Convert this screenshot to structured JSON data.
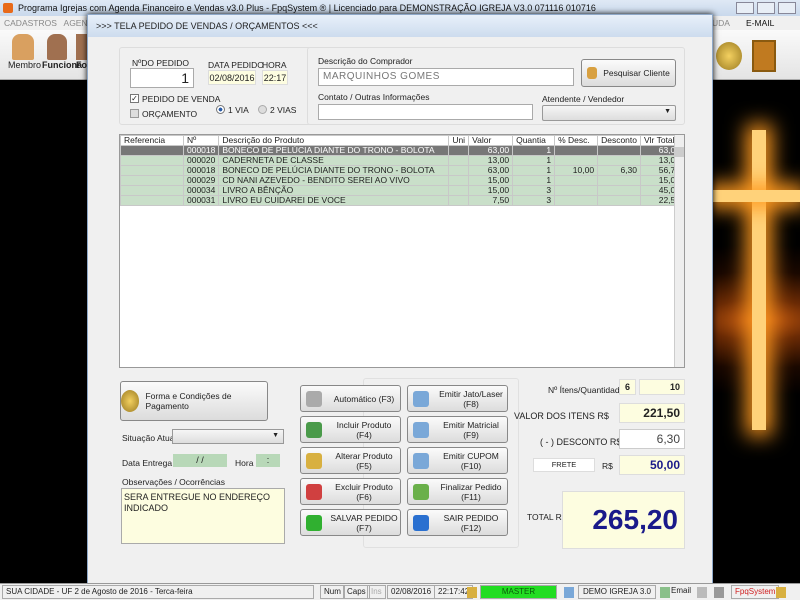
{
  "window": {
    "title": "Programa Igrejas com Agenda Financeiro e Vendas v3.0 Plus - FpqSystem ® | Licenciado para  DEMONSTRAÇÃO IGREJA V3.0 071116 010716"
  },
  "menu": {
    "items": [
      "CADASTROS",
      "AGENDA"
    ],
    "right": "UDA",
    "email": "E-MAIL"
  },
  "toolbar": {
    "items": [
      "Membro",
      "Funcioná",
      "For"
    ]
  },
  "dialog": {
    "title": ">>>  TELA PEDIDO DE VENDAS / ORÇAMENTOS  <<<",
    "pedido": {
      "num_label": "NºDO PEDIDO",
      "num": "1",
      "data_label": "DATA PEDIDO",
      "data": "02/08/2016",
      "hora_label": "HORA",
      "hora": "22:17",
      "pedido_venda": "PEDIDO DE VENDA",
      "pedido_venda_checked": true,
      "orcamento": "ORÇAMENTO",
      "orcamento_checked": false,
      "via1": "1 VIA",
      "via2": "2 VIAS",
      "via_selected": "1 VIA"
    },
    "comprador": {
      "label": "Descrição do Comprador",
      "value": "MARQUINHOS GOMES",
      "pesquisar": "Pesquisar Cliente",
      "contato_label": "Contato / Outras Informações",
      "contato": "",
      "atendente_label": "Atendente / Vendedor",
      "atendente": ""
    },
    "table": {
      "headers": [
        "Referencia",
        "Nº",
        "Descrição do Produto",
        "Uni",
        "Valor",
        "Quantia",
        "% Desc.",
        "Desconto",
        "Vlr Total"
      ],
      "rows": [
        [
          "",
          "000018",
          "BONECO DE PELÚCIA DIANTE DO TRONO - BOLOTA",
          "",
          "63,00",
          "1",
          "",
          "",
          "63,00"
        ],
        [
          "",
          "000020",
          "CADERNETA DE CLASSE",
          "",
          "13,00",
          "1",
          "",
          "",
          "13,00"
        ],
        [
          "",
          "000018",
          "BONECO DE PELÚCIA DIANTE DO TRONO - BOLOTA",
          "",
          "63,00",
          "1",
          "10,00",
          "6,30",
          "56,70"
        ],
        [
          "",
          "000029",
          "CD NANI AZEVEDO - BENDITO SEREI AO VIVO",
          "",
          "15,00",
          "1",
          "",
          "",
          "15,00"
        ],
        [
          "",
          "000034",
          "LIVRO A BÊNÇÃO",
          "",
          "15,00",
          "3",
          "",
          "",
          "45,00"
        ],
        [
          "",
          "000031",
          "LIVRO EU CUIDAREI DE VOCE",
          "",
          "7,50",
          "3",
          "",
          "",
          "22,50"
        ]
      ]
    },
    "left": {
      "pagamento": "Forma e Condições de Pagamento",
      "situacao_label": "Situação Atual",
      "situacao": "",
      "data_entrega_label": "Data  Entrega",
      "data_entrega": " / /",
      "hora_label": "Hora",
      "hora": " :",
      "obs_label": "Observações / Ocorrências",
      "obs": "SERA ENTREGUE NO ENDEREÇO INDICADO"
    },
    "buttons": [
      [
        "Automático      (F3)",
        "Emitir Jato/Laser (F8)"
      ],
      [
        "Incluir Produto  (F4)",
        "Emitir Matricial  (F9)"
      ],
      [
        "Alterar Produto  (F5)",
        "Emitir CUPOM   (F10)"
      ],
      [
        "Excluir Produto  (F6)",
        "Finalizar Pedido  (F11)"
      ],
      [
        "SALVAR PEDIDO (F7)",
        "SAIR  PEDIDO  (F12)"
      ]
    ],
    "totais": {
      "itens_label": "Nº Ítens/Quantidade",
      "itens": "6",
      "quantidade": "10",
      "valor_label": "VALOR DOS ITENS R$",
      "valor": "221,50",
      "desconto_label": "( - ) DESCONTO R$",
      "desconto": "6,30",
      "frete_label": "FRETE",
      "frete_rs": "R$",
      "frete": "50,00",
      "total_label": "TOTAL R$",
      "total": "265,20"
    }
  },
  "status": {
    "city": "SUA CIDADE - UF  2 de Agosto de 2016 - Terca-feira",
    "num": "Num",
    "caps": "Caps",
    "ins": "Ins",
    "date": "02/08/2016",
    "time": "22:17:42",
    "user": "MASTER",
    "company": "DEMO IGREJA 3.0",
    "email": "Email",
    "brand": "FpqSystem"
  },
  "colors": {
    "row_green": "#c9dfc9",
    "field_yellow": "#fdfde0",
    "total_blue": "#1a1a8a",
    "master_green": "#22dd22"
  }
}
